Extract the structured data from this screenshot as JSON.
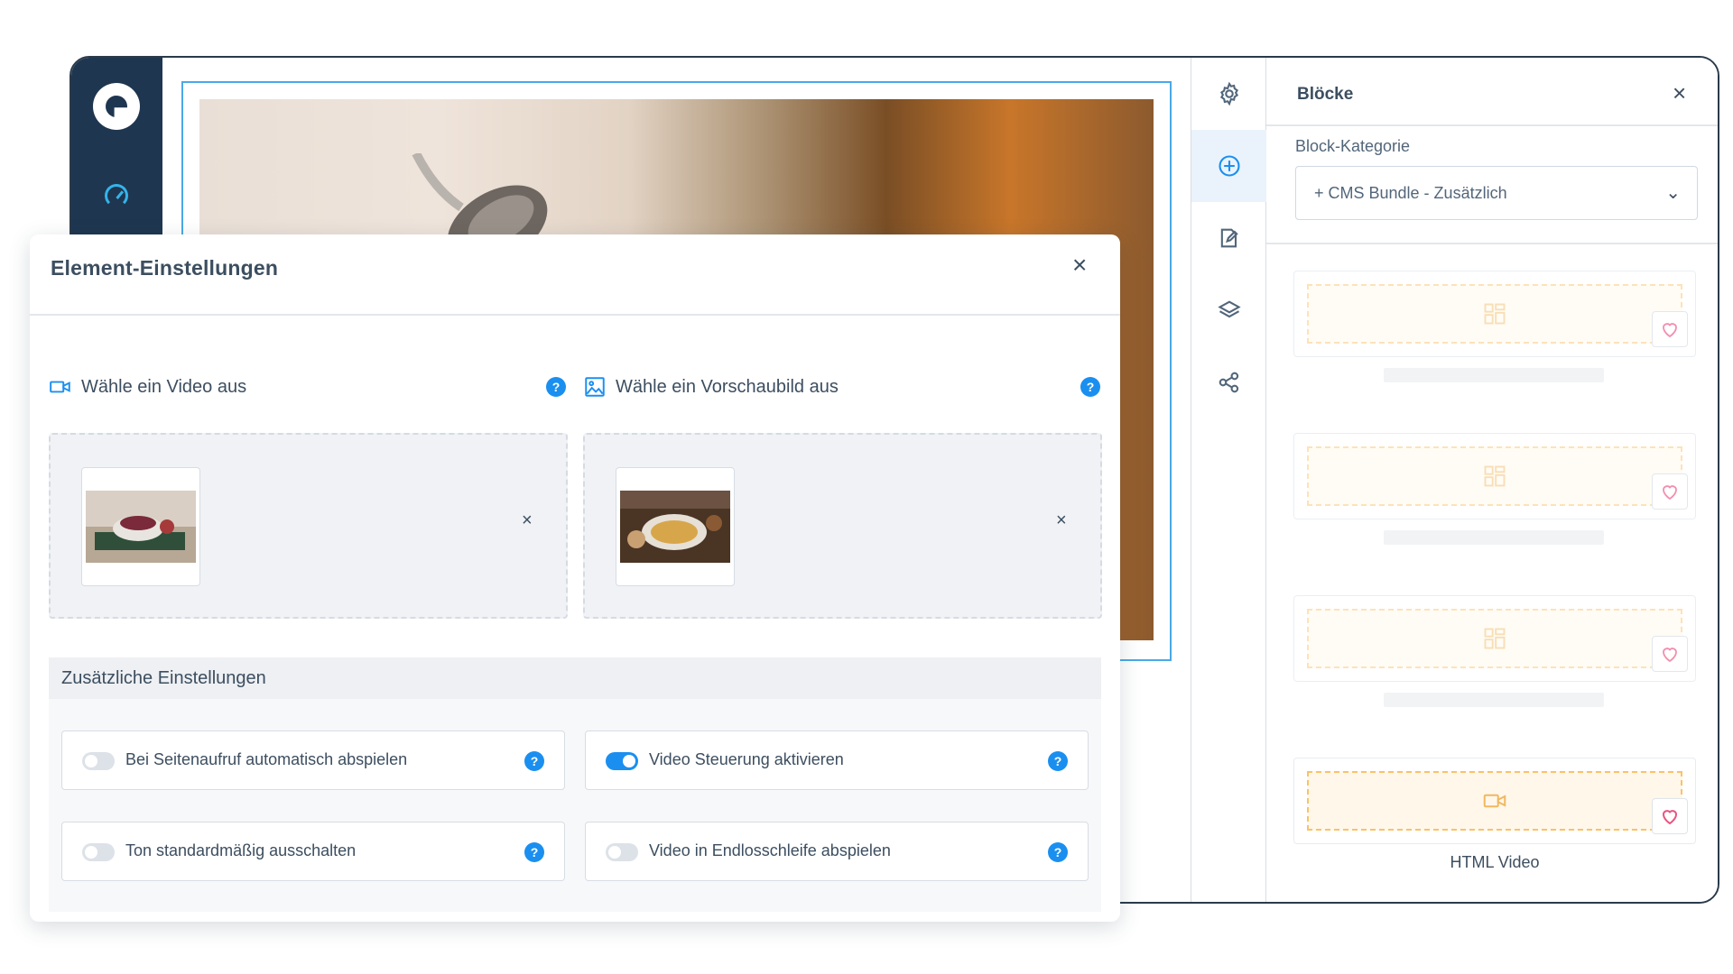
{
  "modal": {
    "title": "Element-Einstellungen",
    "close": "×",
    "video_label": "Wähle ein Video aus",
    "preview_label": "Wähle ein Vorschaubild aus",
    "help": "?",
    "remove": "×",
    "section_title": "Zusätzliche Einstellungen",
    "options": [
      {
        "label": "Bei Seitenaufruf automatisch abspielen",
        "on": false
      },
      {
        "label": "Video Steuerung aktivieren",
        "on": true
      },
      {
        "label": "Ton standardmäßig ausschalten",
        "on": false
      },
      {
        "label": "Video in Endlosschleife abspielen",
        "on": false
      }
    ]
  },
  "blocks_panel": {
    "title": "Blöcke",
    "close": "×",
    "category_label": "Block-Kategorie",
    "category_value": "+ CMS Bundle - Zusätzlich",
    "chevron": "⌄",
    "last_block_name": "HTML Video"
  },
  "colors": {
    "sidebar": "#1f3650",
    "accent": "#1a8ff0",
    "block_dash": "#f9c26a",
    "favorite": "#e9547f"
  },
  "icons": {
    "tools": [
      "gear-icon",
      "plus-circle-icon",
      "edit-icon",
      "layers-icon",
      "share-icon"
    ]
  }
}
